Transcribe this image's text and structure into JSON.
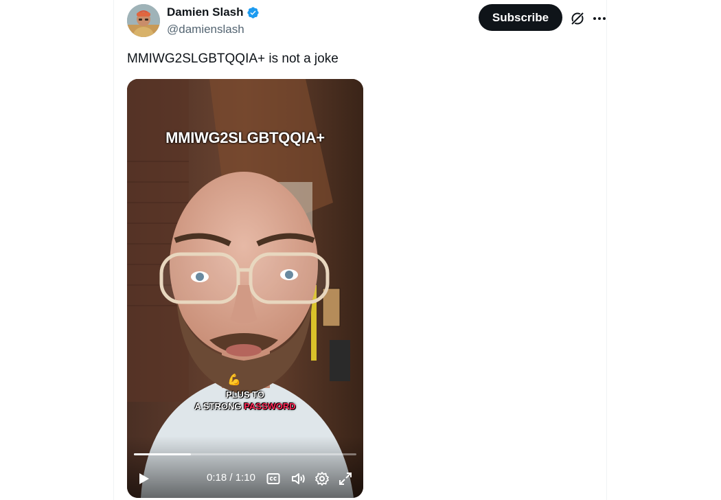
{
  "author": {
    "display_name": "Damien Slash",
    "handle": "@damienslash",
    "verified": true
  },
  "actions": {
    "subscribe_label": "Subscribe",
    "grok_icon": "grok-icon",
    "more_icon": "more-icon"
  },
  "tweet": {
    "text": "MMIWG2SLGBTQQIA+ is not a joke"
  },
  "video": {
    "overlay_title": "MMIWG2SLGBTQQIA+",
    "caption_emoji": "💪",
    "caption_line1": "PLUS TO",
    "caption_line2_prefix": "A STRONG ",
    "caption_line2_highlight": "PASSWORD",
    "current_time": "0:18",
    "duration": "1:10",
    "time_separator": " / ",
    "progress_fraction": 0.257
  },
  "colors": {
    "subscribe_bg": "#0f1419",
    "verified_badge": "#1d9bf0",
    "caption_highlight": "#ff2a58"
  }
}
